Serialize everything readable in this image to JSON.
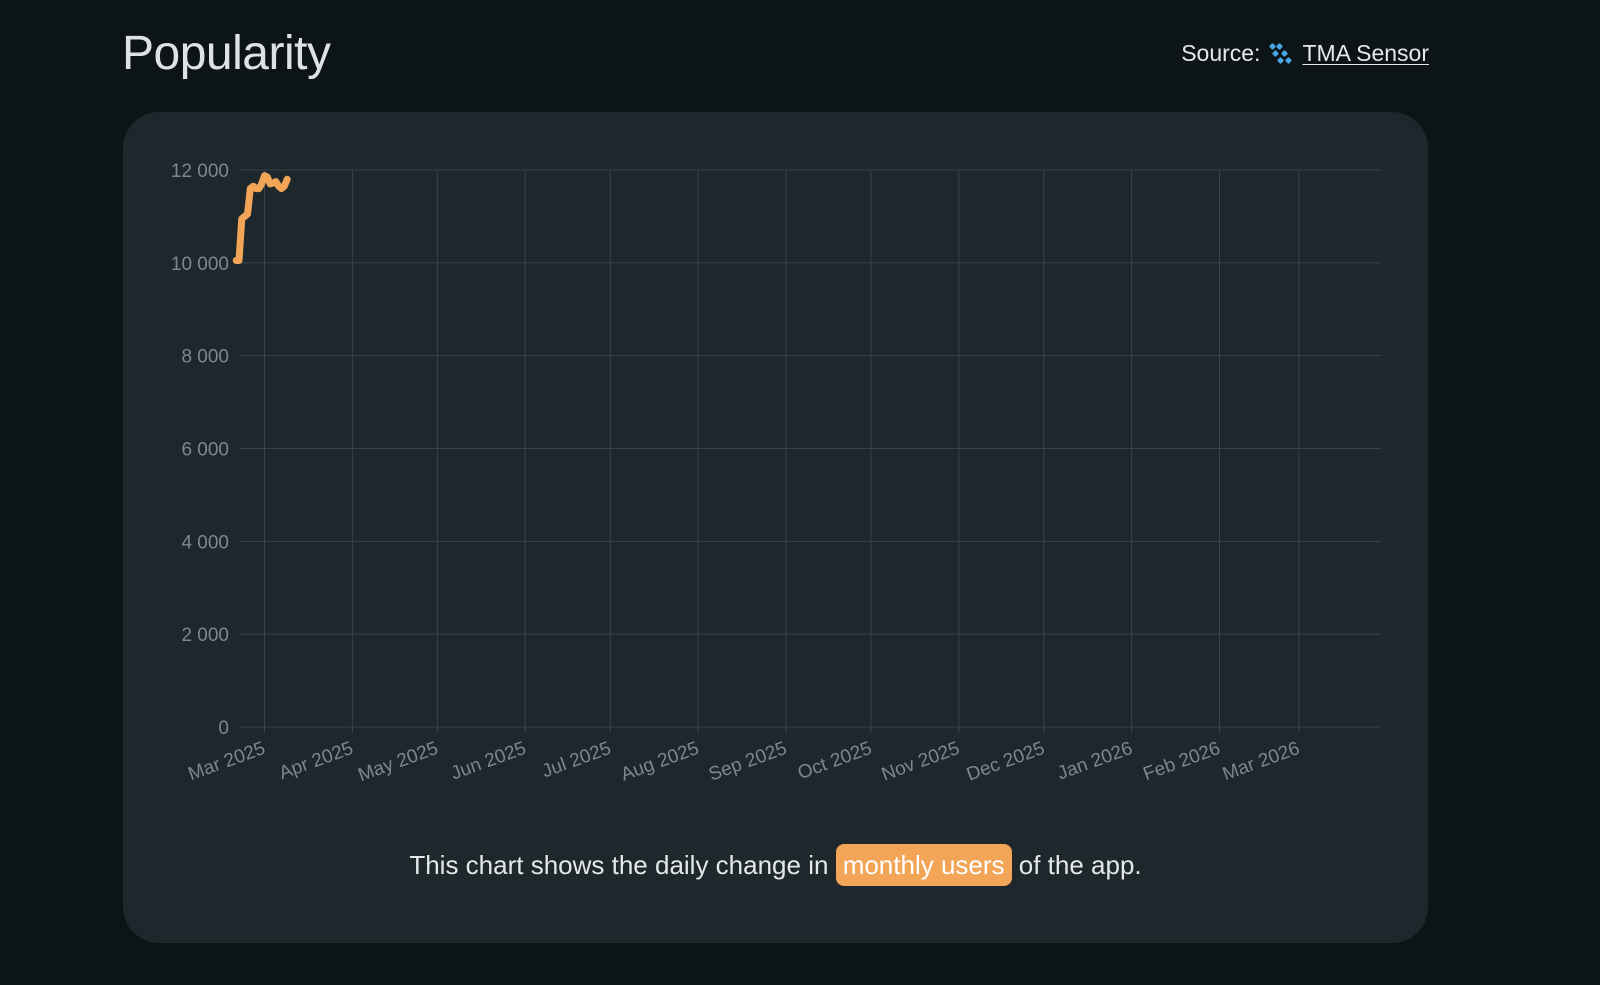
{
  "page": {
    "title": "Popularity"
  },
  "source": {
    "label": "Source:",
    "link_text": "TMA Sensor",
    "icon": "tma-sensor-logo-icon",
    "icon_color": "#4aa7e6"
  },
  "caption": {
    "before": "This chart shows the daily change in",
    "highlight": "monthly users",
    "after": "of the app.",
    "highlight_color": "#f2a557"
  },
  "colors": {
    "background": "#0d1417",
    "card": "#1e272c",
    "grid": "#3b4448",
    "series": "#f2a557"
  },
  "chart_data": {
    "type": "line",
    "x_unit": "date",
    "ylim": [
      0,
      12000
    ],
    "yticks": [
      {
        "value": 0,
        "label": "0"
      },
      {
        "value": 2000,
        "label": "2 000"
      },
      {
        "value": 4000,
        "label": "4 000"
      },
      {
        "value": 6000,
        "label": "6 000"
      },
      {
        "value": 8000,
        "label": "8 000"
      },
      {
        "value": 10000,
        "label": "10 000"
      },
      {
        "value": 12000,
        "label": "12 000"
      }
    ],
    "xlim": [
      "2025-02-20",
      "2026-03-30"
    ],
    "xticks": [
      {
        "value": "2025-03-01",
        "label": "Mar 2025"
      },
      {
        "value": "2025-04-01",
        "label": "Apr 2025"
      },
      {
        "value": "2025-05-01",
        "label": "May 2025"
      },
      {
        "value": "2025-06-01",
        "label": "Jun 2025"
      },
      {
        "value": "2025-07-01",
        "label": "Jul 2025"
      },
      {
        "value": "2025-08-01",
        "label": "Aug 2025"
      },
      {
        "value": "2025-09-01",
        "label": "Sep 2025"
      },
      {
        "value": "2025-10-01",
        "label": "Oct 2025"
      },
      {
        "value": "2025-11-01",
        "label": "Nov 2025"
      },
      {
        "value": "2025-12-01",
        "label": "Dec 2025"
      },
      {
        "value": "2026-01-01",
        "label": "Jan 2026"
      },
      {
        "value": "2026-02-01",
        "label": "Feb 2026"
      },
      {
        "value": "2026-03-01",
        "label": "Mar 2026"
      }
    ],
    "grid": true,
    "legend": "none",
    "series": [
      {
        "color": "#f2a557",
        "points": [
          {
            "x": "2025-02-19",
            "y": 10050
          },
          {
            "x": "2025-02-20",
            "y": 10050
          },
          {
            "x": "2025-02-21",
            "y": 10950
          },
          {
            "x": "2025-02-22",
            "y": 11000
          },
          {
            "x": "2025-02-23",
            "y": 11050
          },
          {
            "x": "2025-02-24",
            "y": 11600
          },
          {
            "x": "2025-02-25",
            "y": 11650
          },
          {
            "x": "2025-02-26",
            "y": 11600
          },
          {
            "x": "2025-02-27",
            "y": 11600
          },
          {
            "x": "2025-02-28",
            "y": 11700
          },
          {
            "x": "2025-03-01",
            "y": 11880
          },
          {
            "x": "2025-03-02",
            "y": 11850
          },
          {
            "x": "2025-03-03",
            "y": 11700
          },
          {
            "x": "2025-03-04",
            "y": 11720
          },
          {
            "x": "2025-03-05",
            "y": 11750
          },
          {
            "x": "2025-03-06",
            "y": 11650
          },
          {
            "x": "2025-03-07",
            "y": 11600
          },
          {
            "x": "2025-03-08",
            "y": 11650
          },
          {
            "x": "2025-03-09",
            "y": 11800
          }
        ]
      }
    ]
  }
}
